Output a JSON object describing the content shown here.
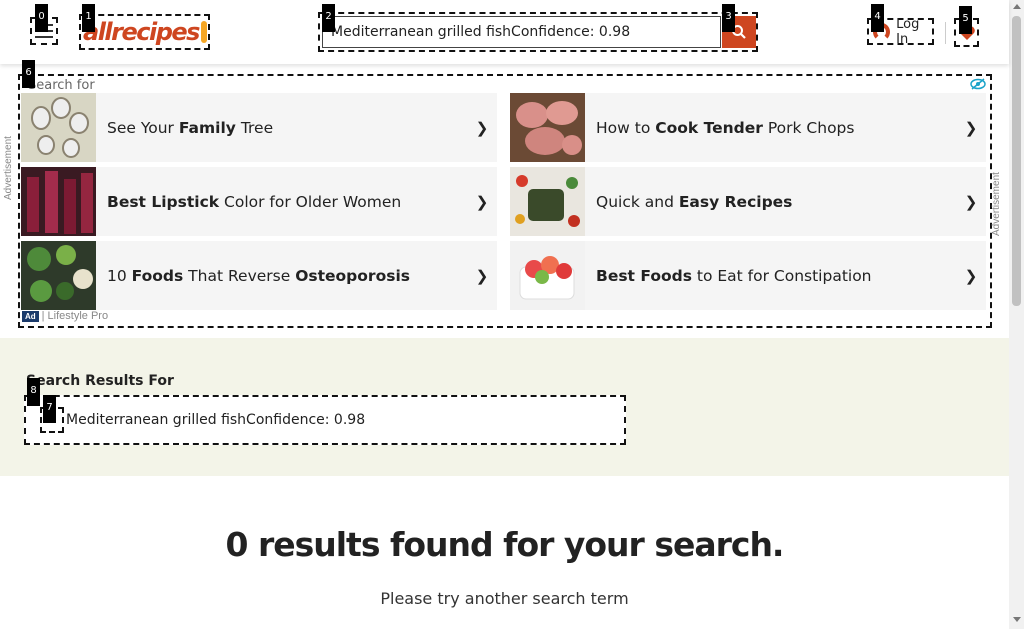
{
  "header": {
    "logo_text": "allrecipes",
    "search_value": "Mediterranean grilled fishConfidence: 0.98",
    "login_label": "Log In",
    "brand_color": "#ce4620"
  },
  "badges": [
    "0",
    "1",
    "2",
    "3",
    "4",
    "5",
    "6",
    "7",
    "8"
  ],
  "ad": {
    "search_for": "Search for",
    "side_label": "Advertisement",
    "footer": "Lifestyle Pro",
    "footer_tag": "Ad",
    "items": [
      {
        "pre": "See Your ",
        "bold": "Family",
        "post": " Tree",
        "arrow": "❯"
      },
      {
        "pre": "How to ",
        "bold": "Cook Tender",
        "post": " Pork Chops",
        "arrow": "❯"
      },
      {
        "pre": "",
        "bold": "Best Lipstick",
        "post": " Color for Older Women",
        "arrow": "❯"
      },
      {
        "pre": "Quick and ",
        "bold": "Easy Recipes",
        "post": "",
        "arrow": "❯"
      },
      {
        "pre": "10 ",
        "bold": "Foods",
        "post": " That Reverse ",
        "bold2": "Osteoporosis",
        "arrow": "❯"
      },
      {
        "pre": "",
        "bold": "Best Foods",
        "post": " to Eat for Constipation",
        "arrow": "❯"
      }
    ]
  },
  "results": {
    "label": "Search Results For",
    "term": "Mediterranean grilled fishConfidence: 0.98",
    "none_title": "0 results found for your search.",
    "none_sub": "Please try another search term"
  }
}
